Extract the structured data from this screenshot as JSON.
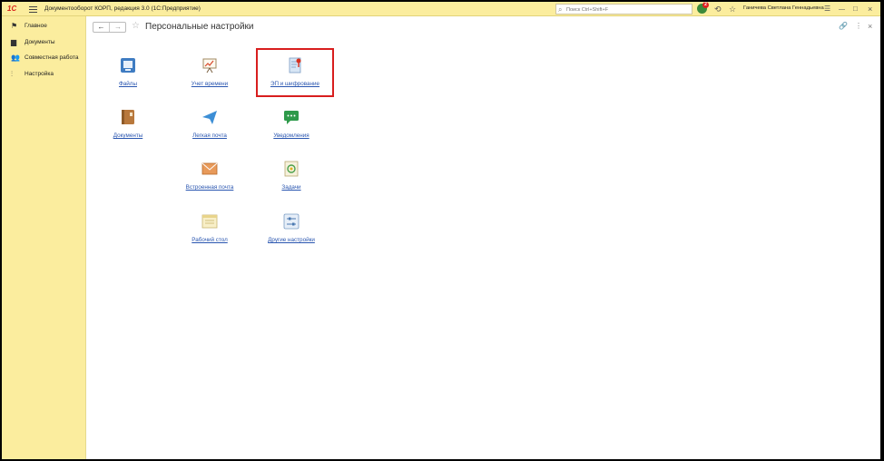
{
  "app": {
    "logo_text": "1С",
    "title": "Документооборот КОРП, редакция 3.0  (1С:Предприятие)",
    "search_placeholder": "Поиск Ctrl+Shift+F",
    "notifications_count": "2",
    "user_name": "Ганичева Светлана Геннадьевна"
  },
  "sidebar": {
    "items": [
      {
        "label": "Главное",
        "icon": "flag-icon"
      },
      {
        "label": "Документы",
        "icon": "folder-icon"
      },
      {
        "label": "Совместная работа",
        "icon": "people-icon"
      },
      {
        "label": "Настройка",
        "icon": "sliders-icon"
      }
    ]
  },
  "page": {
    "title": "Персональные настройки"
  },
  "tiles": [
    {
      "label": "Файлы",
      "icon": "files-icon"
    },
    {
      "label": "Учет времени",
      "icon": "time-tracking-icon"
    },
    {
      "label": "ЭП и шифрование",
      "icon": "digital-signature-icon"
    },
    {
      "label": "Документы",
      "icon": "documents-icon"
    },
    {
      "label": "Легкая почта",
      "icon": "paper-plane-icon"
    },
    {
      "label": "Уведомления",
      "icon": "chat-icon"
    },
    {
      "label": "Встроенная почта",
      "icon": "envelope-icon"
    },
    {
      "label": "Задачи",
      "icon": "tasks-icon"
    },
    {
      "label": "Рабочий стол",
      "icon": "desktop-icon"
    },
    {
      "label": "Другие настройки",
      "icon": "settings-icon"
    }
  ],
  "colors": {
    "accent_yellow": "#fbed9e",
    "link_blue": "#2a56b0",
    "highlight_red": "#d81e1e"
  }
}
